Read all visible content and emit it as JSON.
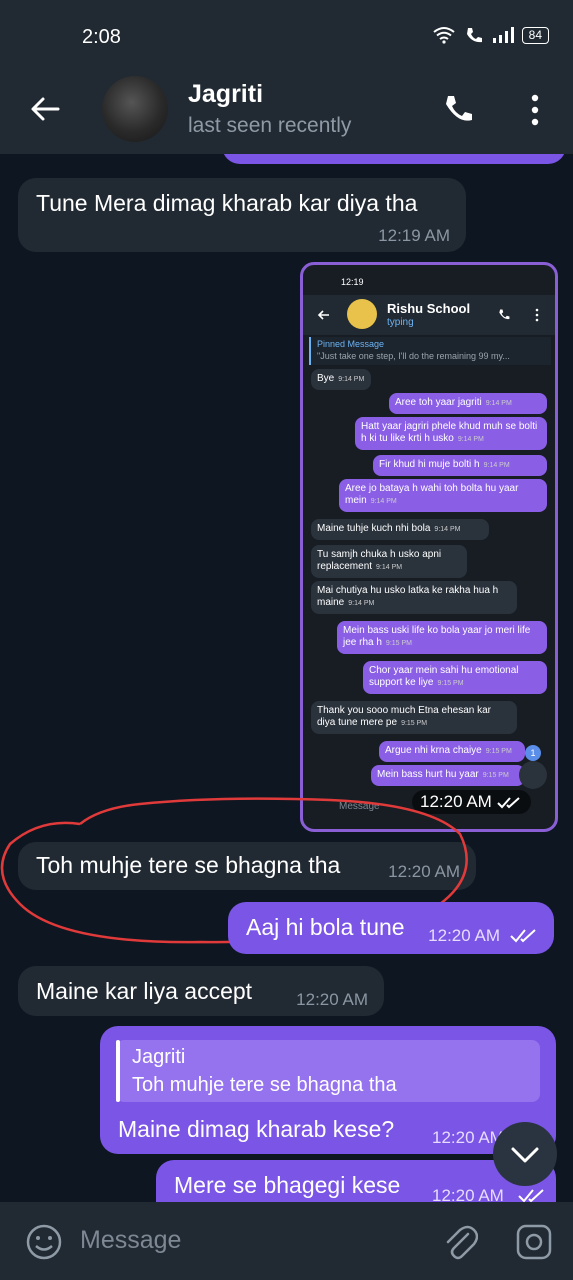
{
  "status_bar": {
    "time": "2:08",
    "battery": "84"
  },
  "header": {
    "contact_name": "Jagriti",
    "status": "last seen recently"
  },
  "messages": [
    {
      "text": "Tune Mera dimag kharab kar diya tha",
      "time": "12:19 AM"
    },
    {
      "time": "12:20 AM"
    },
    {
      "text": "Toh muhje tere se bhagna tha",
      "time": "12:20 AM"
    },
    {
      "text": "Aaj hi bola tune",
      "time": "12:20 AM"
    },
    {
      "text": "Maine kar liya accept",
      "time": "12:20 AM"
    },
    {
      "reply_name": "Jagriti",
      "reply_text": "Toh muhje tere se bhagna tha",
      "text": "Maine dimag kharab kese?",
      "time": "12:20 AM"
    },
    {
      "text": "Mere se bhagegi kese",
      "time": "12:20 AM"
    }
  ],
  "screenshot": {
    "time": "12:19",
    "name": "Rishu School",
    "status": "typing",
    "pinned_title": "Pinned Message",
    "pinned_text": "\"Just take one step, I'll do the remaining 99 my...",
    "msgs": [
      {
        "text": "Bye",
        "time": "9:14 PM"
      },
      {
        "text": "Aree toh yaar jagriti",
        "time": "9:14 PM"
      },
      {
        "text": "Hatt yaar jagriri phele khud muh se bolti h ki tu like krti h usko",
        "time": "9:14 PM"
      },
      {
        "text": "Fir khud hi muje bolti h",
        "time": "9:14 PM"
      },
      {
        "text": "Aree jo bataya h wahi toh bolta hu yaar mein",
        "time": "9:14 PM"
      },
      {
        "text": "Maine tuhje kuch nhi bola",
        "time": "9:14 PM"
      },
      {
        "text": "Tu samjh chuka h usko apni replacement",
        "time": "9:14 PM"
      },
      {
        "text": "Mai chutiya hu usko latka ke rakha hua h maine",
        "time": "9:14 PM"
      },
      {
        "text": "Mein bass uski life ko bola yaar jo meri life jee rha h",
        "time": "9:15 PM"
      },
      {
        "text": "Chor yaar mein sahi hu emotional support ke liye",
        "time": "9:15 PM"
      },
      {
        "text": "Thank you sooo much Etna ehesan kar diya tune mere pe",
        "time": "9:15 PM"
      },
      {
        "text": "Argue nhi krna chaiye",
        "time": "9:15 PM"
      },
      {
        "text": "Mein bass hurt hu yaar",
        "time": "9:15 PM"
      }
    ],
    "unread_badge": "1",
    "input_placeholder": "Message"
  },
  "input": {
    "placeholder": "Message"
  },
  "colors": {
    "outgoing": "#7b55e6",
    "incoming": "#212a33",
    "background": "#0e1621",
    "annotation": "#e03a3a"
  }
}
